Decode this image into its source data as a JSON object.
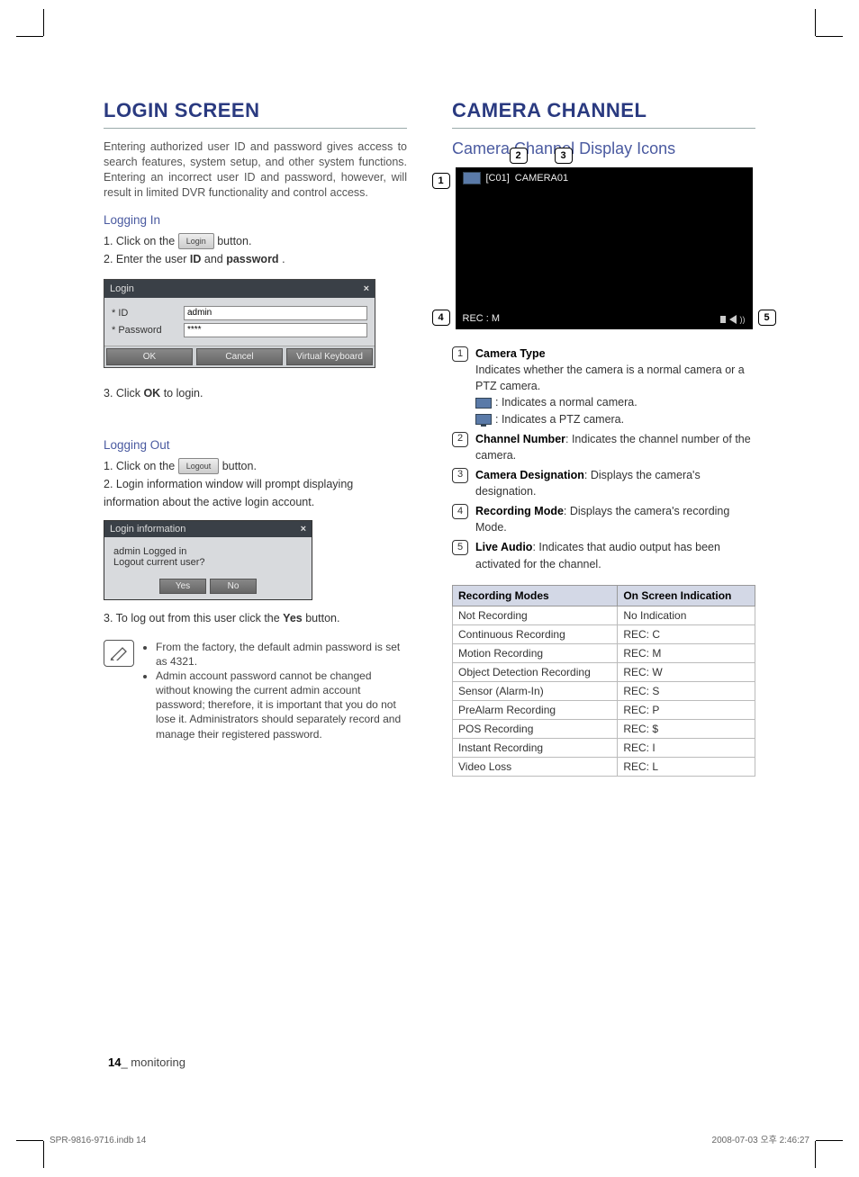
{
  "left": {
    "heading": "LOGIN SCREEN",
    "intro": "Entering authorized user ID and password gives access to search features, system setup, and other system functions. Entering an incorrect user ID and password, however, will result in limited DVR functionality and control access.",
    "logging_in_head": "Logging In",
    "login_step1_a": "1. Click on the ",
    "login_step1_btn": "Login",
    "login_step1_b": " button.",
    "login_step2_a": "2. Enter the user ",
    "login_step2_id": "ID",
    "login_step2_and": " and ",
    "login_step2_pw": "password",
    "login_step2_end": ".",
    "login_dialog": {
      "title": "Login",
      "id_label": "*   ID",
      "id_value": "admin",
      "pw_label": "*   Password",
      "pw_value": "****",
      "ok": "OK",
      "cancel": "Cancel",
      "vkbd": "Virtual Keyboard"
    },
    "login_step3_a": "3. Click ",
    "login_step3_b": "OK",
    "login_step3_c": " to login.",
    "logging_out_head": "Logging Out",
    "logout_step1_a": "1. Click on the ",
    "logout_step1_btn": "Logout",
    "logout_step1_b": " button.",
    "logout_step2": "2. Login information window will prompt displaying information about the active login account.",
    "info_dialog": {
      "title": "Login information",
      "line1": "admin Logged in",
      "line2": "Logout current user?",
      "yes": "Yes",
      "no": "No"
    },
    "logout_step3_a": "3. To log out from this user click the ",
    "logout_step3_b": "Yes",
    "logout_step3_c": " button.",
    "notes": [
      "From the factory, the default admin password is set as 4321.",
      "Admin account password cannot be changed without knowing the current admin account password; therefore, it is important that you do not lose it. Administrators should separately record and manage their registered password."
    ]
  },
  "right": {
    "heading": "CAMERA CHANNEL",
    "subheading": "Camera Channel Display Icons",
    "panel": {
      "channel": "[C01]",
      "name": "CAMERA01",
      "rec": "REC : M",
      "callouts": {
        "c1": "1",
        "c2": "2",
        "c3": "3",
        "c4": "4",
        "c5": "5"
      }
    },
    "annotations": [
      {
        "n": "1",
        "title": "Camera Type",
        "body": "Indicates whether the camera is a normal camera or a PTZ camera.",
        "sub": [
          ": Indicates a normal camera.",
          ": Indicates a PTZ camera."
        ],
        "iconed": true
      },
      {
        "n": "2",
        "title": "Channel Number",
        "body": ": Indicates the channel number of the camera."
      },
      {
        "n": "3",
        "title": "Camera Designation",
        "body": ": Displays the camera's designation."
      },
      {
        "n": "4",
        "title": "Recording Mode",
        "body": ": Displays the camera's recording Mode."
      },
      {
        "n": "5",
        "title": "Live Audio",
        "body": ": Indicates that audio output has been activated for the channel."
      }
    ],
    "table": {
      "headers": [
        "Recording Modes",
        "On Screen Indication"
      ],
      "rows": [
        [
          "Not Recording",
          "No Indication"
        ],
        [
          "Continuous Recording",
          "REC: C"
        ],
        [
          "Motion Recording",
          "REC: M"
        ],
        [
          "Object Detection Recording",
          "REC: W"
        ],
        [
          "Sensor (Alarm-In)",
          "REC: S"
        ],
        [
          "PreAlarm Recording",
          "REC: P"
        ],
        [
          "POS Recording",
          "REC: $"
        ],
        [
          "Instant Recording",
          "REC: I"
        ],
        [
          "Video Loss",
          "REC: L"
        ]
      ]
    }
  },
  "footer": {
    "page_num": "14",
    "section": "_ monitoring",
    "print_left": "SPR-9816-9716.indb   14",
    "print_right": "2008-07-03   오후 2:46:27"
  }
}
